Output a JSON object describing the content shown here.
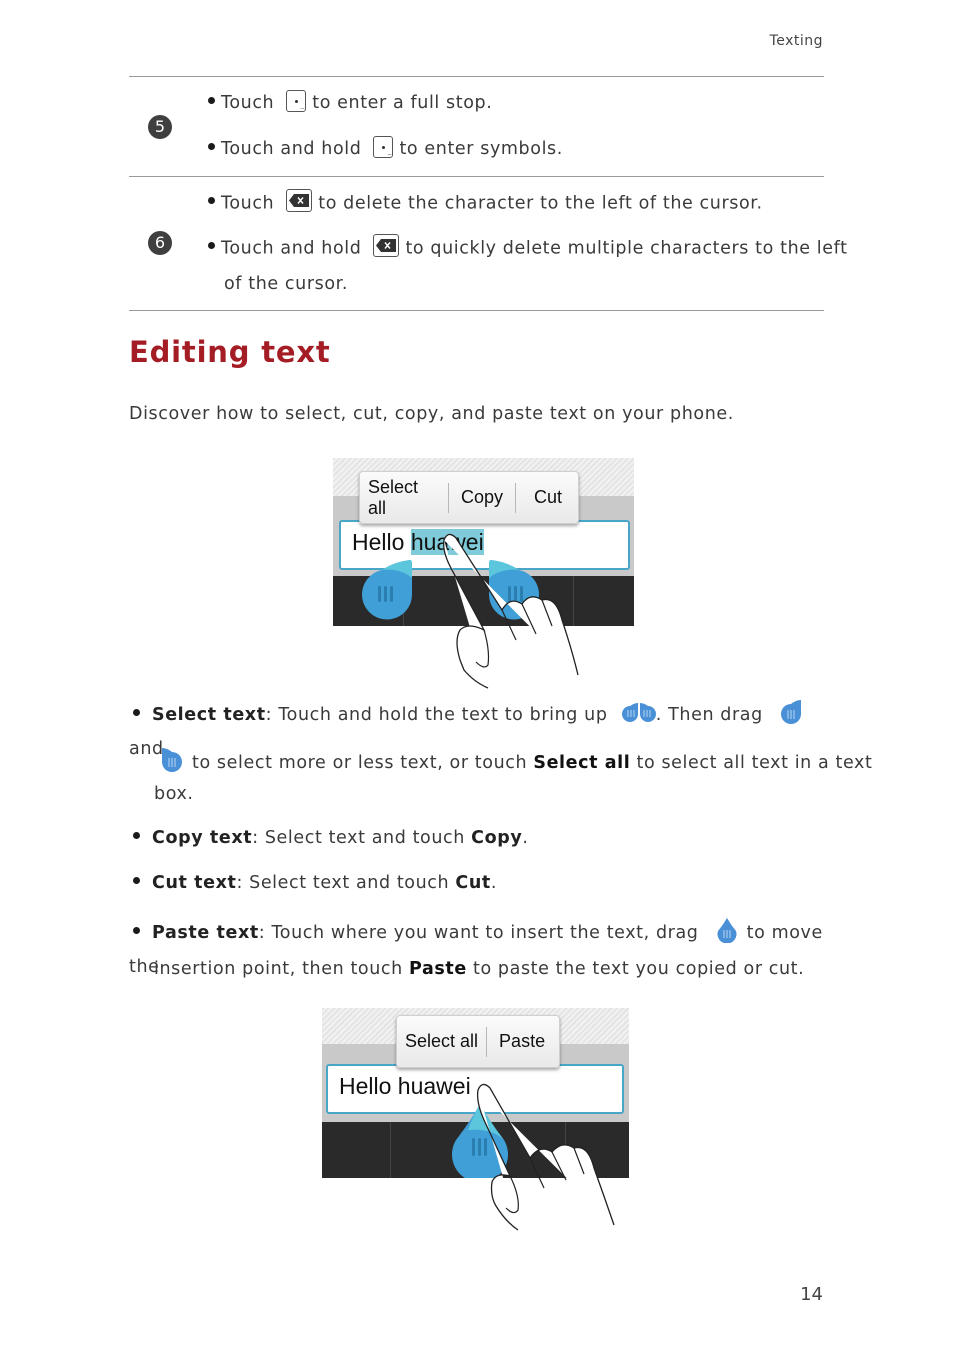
{
  "header": {
    "section": "Texting"
  },
  "key_table": [
    {
      "number": "5",
      "lines": [
        {
          "prefix": "Touch",
          "icon": "full-stop-key-icon",
          "suffix": "to enter a full stop."
        },
        {
          "prefix": "Touch and hold",
          "icon": "full-stop-key-icon",
          "suffix": "to enter symbols."
        }
      ]
    },
    {
      "number": "6",
      "lines": [
        {
          "prefix": "Touch",
          "icon": "delete-key-icon",
          "suffix": "to delete the character to the left of the cursor."
        },
        {
          "prefix": "Touch and hold",
          "icon": "delete-key-icon",
          "suffix": "to quickly delete multiple characters to the left"
        }
      ],
      "continuation": "of the cursor."
    }
  ],
  "section": {
    "title": "Editing text",
    "intro": "Discover how to select, cut, copy, and paste text on your phone."
  },
  "illustration_1": {
    "popup": [
      "Select all",
      "Copy",
      "Cut"
    ],
    "text_before": "Hello ",
    "text_selected": "huawei",
    "colors": {
      "selection": "#7fcbd9",
      "handle": "#3f9fd6",
      "textbox_border": "#4aa6c9"
    }
  },
  "bullets": {
    "select": {
      "label": "Select text",
      "t1": ": Touch and hold the text to bring up",
      "t2": ". Then drag",
      "t3": "and",
      "t4": "to select more or less text, or touch",
      "bold": "Select all",
      "t5": "to select all text in a text",
      "t6": "box."
    },
    "copy": {
      "label": "Copy text",
      "t1": ": Select text and touch",
      "bold": "Copy",
      "t2": "."
    },
    "cut": {
      "label": "Cut text",
      "t1": ": Select text and touch",
      "bold": "Cut",
      "t2": "."
    },
    "paste": {
      "label": "Paste text",
      "t1": ": Touch where you want to insert the text, drag",
      "t2": "to move the",
      "t3": "insertion point, then touch",
      "bold": "Paste",
      "t4": "to paste the text you copied or cut."
    }
  },
  "illustration_2": {
    "popup": [
      "Select all",
      "Paste"
    ],
    "text": "Hello huawei"
  },
  "footer": {
    "page_number": "14"
  }
}
